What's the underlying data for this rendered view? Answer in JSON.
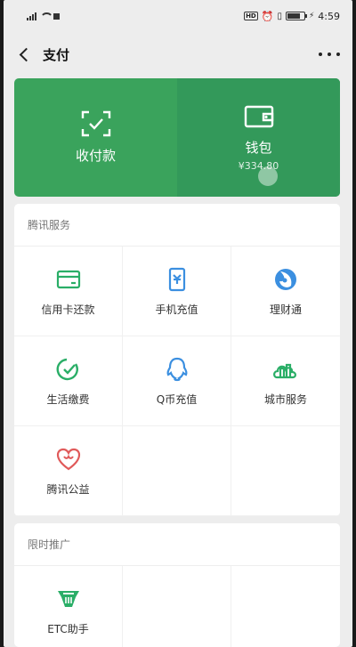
{
  "status_bar": {
    "time": "4:59",
    "hd_badge": "HD"
  },
  "nav": {
    "title": "支付"
  },
  "green_card": {
    "collect_pay_label": "收付款",
    "wallet_label": "钱包",
    "wallet_balance": "¥334.80"
  },
  "tencent_services": {
    "title": "腾讯服务",
    "items": [
      {
        "label": "信用卡还款",
        "icon": "credit-card-icon",
        "color": "#2aae67"
      },
      {
        "label": "手机充值",
        "icon": "phone-topup-icon",
        "color": "#3b8fe0"
      },
      {
        "label": "理财通",
        "icon": "wealth-icon",
        "color": "#3b8fe0"
      },
      {
        "label": "生活缴费",
        "icon": "utilities-icon",
        "color": "#2aae67"
      },
      {
        "label": "Q币充值",
        "icon": "qq-coin-icon",
        "color": "#3b8fe0"
      },
      {
        "label": "城市服务",
        "icon": "city-services-icon",
        "color": "#2aae67"
      },
      {
        "label": "腾讯公益",
        "icon": "charity-icon",
        "color": "#e05a5a"
      }
    ]
  },
  "promo": {
    "title": "限时推广",
    "items": [
      {
        "label": "ETC助手",
        "icon": "etc-icon",
        "color": "#2aae67"
      }
    ]
  },
  "colors": {
    "brand_green": "#3aa35c",
    "brand_green_dark": "#33995a"
  }
}
